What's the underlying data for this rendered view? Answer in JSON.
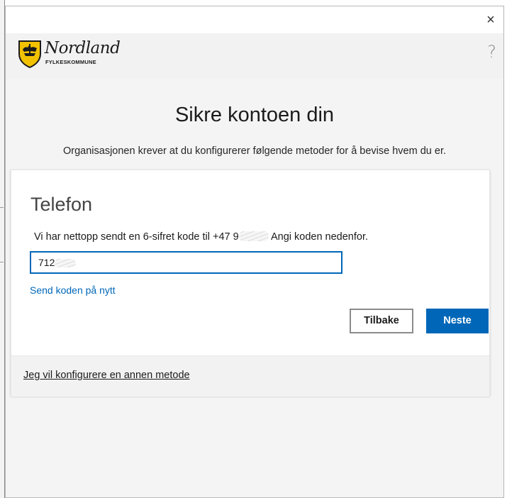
{
  "window": {
    "close_symbol": "×"
  },
  "brand": {
    "name": "Nordland",
    "sub": "FYLKESKOMMUNE",
    "help_symbol": "?",
    "colors": {
      "shield": "#f2c200",
      "outline": "#1b1b1b"
    }
  },
  "page": {
    "title": "Sikre kontoen din",
    "subtitle": "Organisasjonen krever at du konfigurerer følgende metoder for å bevise hvem du er."
  },
  "method": {
    "title": "Telefon",
    "instructions_before": "Vi har nettopp sendt en 6-sifret kode til +47 9",
    "instructions_after": "Angi koden nedenfor.",
    "code_value": "712",
    "resend_label": "Send koden på nytt",
    "back_label": "Tilbake",
    "next_label": "Neste"
  },
  "footer": {
    "other_method_label": "Jeg vil konfigurere en annen metode"
  },
  "colors": {
    "accent": "#0067b8",
    "background": "#f4f4f4",
    "card": "#ffffff"
  }
}
